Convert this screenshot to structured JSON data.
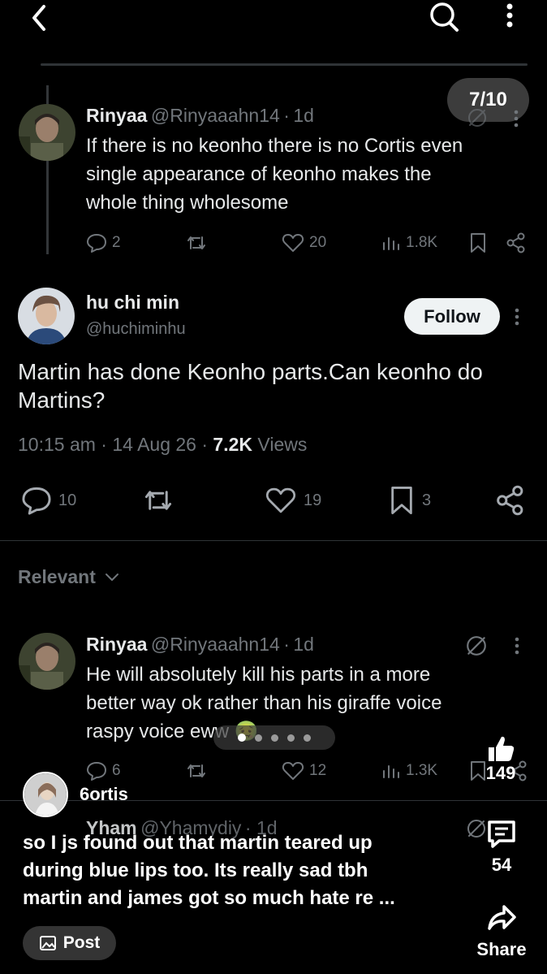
{
  "top_bar": {
    "back_icon": "chevron-left-icon",
    "search_icon": "search-icon",
    "more_icon": "more-vertical-icon"
  },
  "page_indicator": "7/10",
  "parent_reply": {
    "name": "Rinyaa",
    "handle": "@Rinyaaahn14",
    "sep": "·",
    "time": "1d",
    "lines": [
      "If there is no keonho there is no Cortis even",
      "single appearance of keonho makes the",
      "whole thing wholesome"
    ],
    "replies": "2",
    "likes": "20",
    "views": "1.8K"
  },
  "main_post": {
    "name": "hu chi min",
    "handle": "@huchiminhu",
    "follow_label": "Follow",
    "lines": [
      "Martin has done Keonho parts.Can keonho do",
      "Martins?"
    ],
    "time": "10:15 am",
    "dot": "·",
    "date": "14 Aug 26",
    "views_count": "7.2K",
    "views_label": "Views",
    "replies": "10",
    "likes": "19",
    "bookmarks": "3"
  },
  "relevant_label": "Relevant",
  "reply2": {
    "name": "Rinyaa",
    "handle": "@Rinyaaahn14",
    "sep": "·",
    "time": "1d",
    "lines": [
      "He will absolutely kill his parts in a more",
      "better way ok rather than his giraffe voice",
      "raspy voice eww 🤢"
    ],
    "replies": "6",
    "likes": "12",
    "views": "1.3K"
  },
  "reply3_peek": {
    "name": "Yham",
    "handle": "@Yhamydiy",
    "time": "· 1d"
  },
  "carousel": {
    "dot_count": 5,
    "active_index": 0
  },
  "overlay": {
    "author": "6ortis",
    "caption_lines": [
      "so I js found out that martin teared up",
      "during blue lips too. Its really sad tbh",
      "martin and james got so much hate re ..."
    ],
    "likes": "149",
    "comments": "54",
    "share_label": "Share",
    "post_label": "Post"
  },
  "colors": {
    "background": "#000000",
    "text": "#e7e9ea",
    "muted": "#71767b",
    "divider": "#2f3336"
  }
}
